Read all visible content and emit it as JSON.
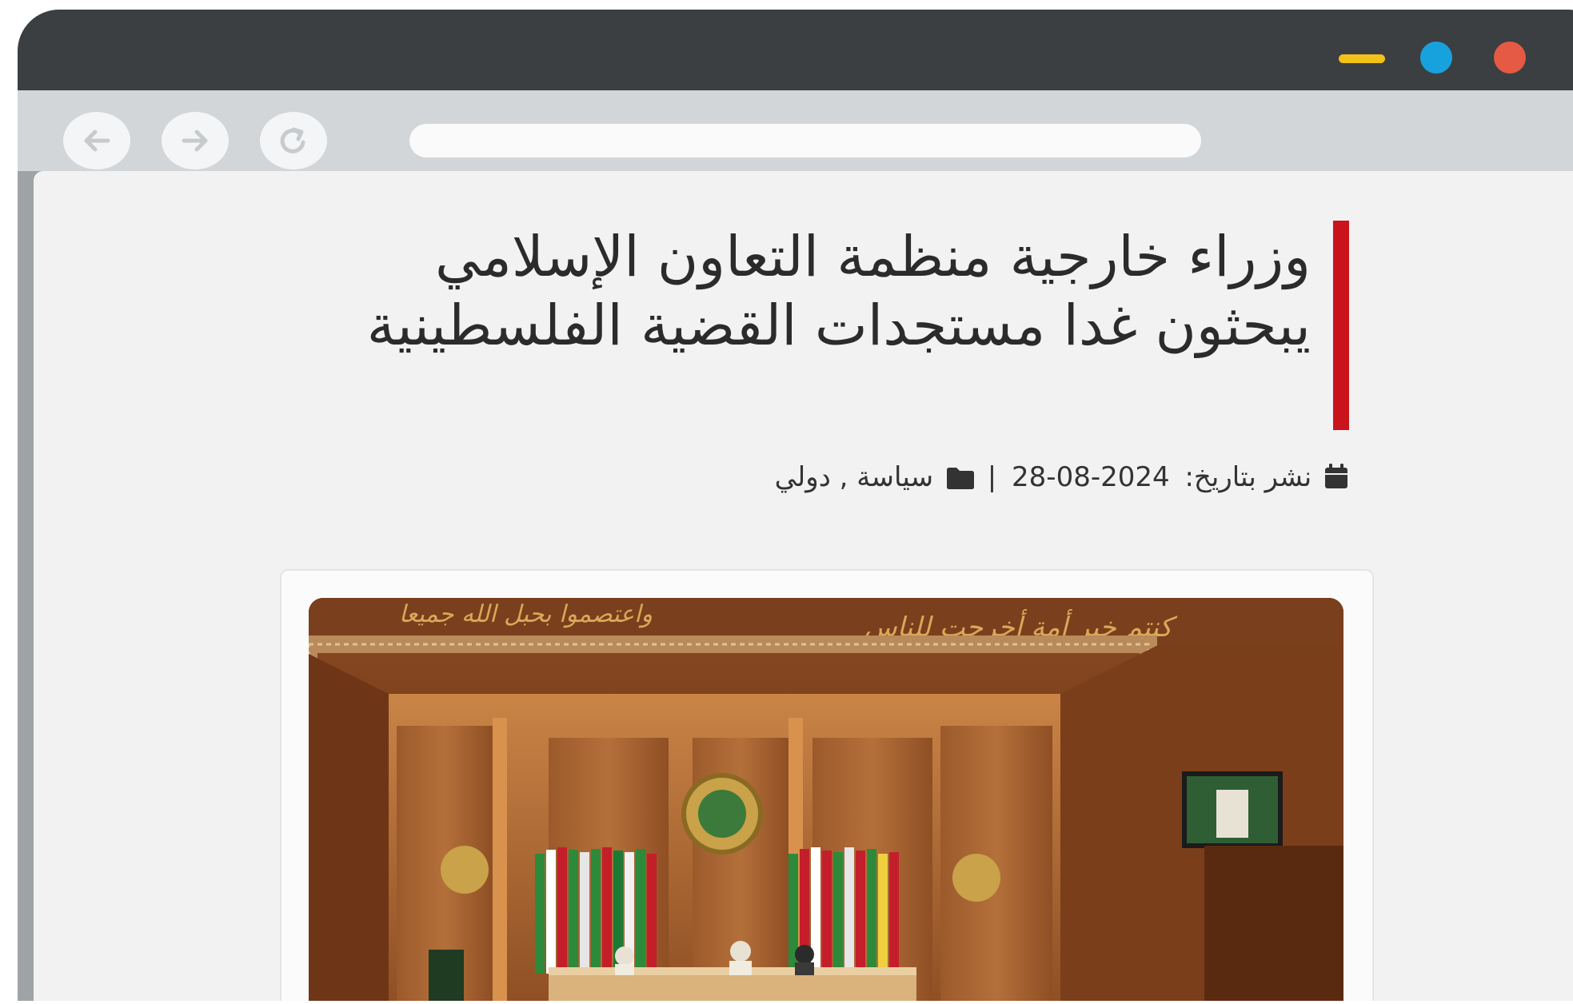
{
  "window": {
    "controls": {
      "close_color": "#e55a44",
      "maximize_color": "#18a2dd",
      "minimize_color": "#f2c21b"
    }
  },
  "toolbar": {
    "back_icon": "arrow-left-icon",
    "forward_icon": "arrow-right-icon",
    "reload_icon": "reload-icon",
    "address": ""
  },
  "article": {
    "headline": "وزراء خارجية منظمة التعاون الإسلامي يبحثون غدا مستجدات القضية الفلسطينية",
    "published_label": "نشر بتاريخ:",
    "date": "2024-08-28",
    "separator": "|",
    "categories": "سياسة , دولي",
    "date_icon": "calendar-icon",
    "category_icon": "folder-icon",
    "accent_color": "#c9141b"
  },
  "photo": {
    "inscriptions": [
      "كنتم خير أمة أخرجت للناس",
      "واعتصموا بحبل الله جميعا"
    ]
  }
}
